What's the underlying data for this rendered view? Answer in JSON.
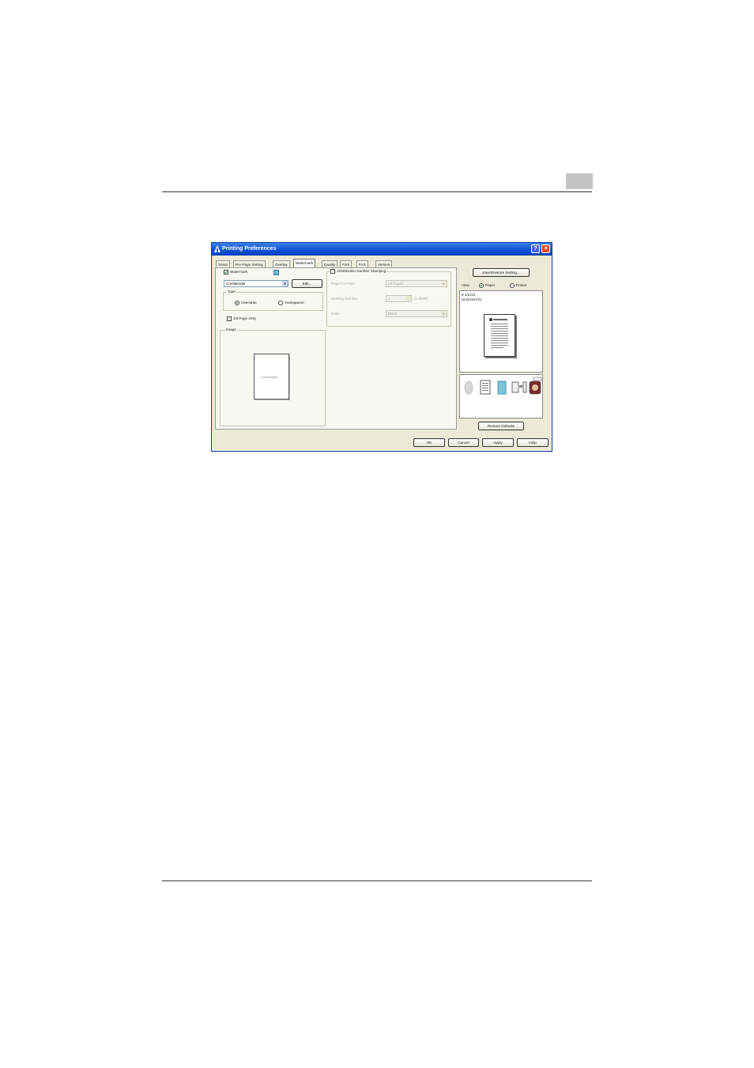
{
  "dialog": {
    "title": "Printing Preferences",
    "help_glyph": "?",
    "close_glyph": "×",
    "tabs": [
      "Setup",
      "Per Page Setting",
      "Overlay",
      "Watermark",
      "Quality",
      "Font",
      "FAX",
      "Version"
    ],
    "active_tab": "Watermark",
    "watermark": {
      "checkbox_label": "Watermark",
      "selected": "Confidential",
      "edit_label": "Edit...",
      "type_label": "Type",
      "overwrite_label": "Overwrite",
      "transparent_label": "Transparent",
      "first_page_label": "1st Page Only",
      "image_label": "Image",
      "preview_text": "Confidential"
    },
    "distribution": {
      "checkbox_label": "Distribution Number Stamping",
      "pages_label": "Pages to Print",
      "pages_value": "All Pages",
      "starting_label": "Starting Number",
      "starting_value": "1",
      "range_text": "[1-9999]",
      "color_label": "Color",
      "color_value": "Black"
    },
    "right": {
      "save_button": "Save/Restore Setting...",
      "view_label": "View",
      "paper_label": "Paper",
      "printer_label": "Printer",
      "paper_size": "8 1/2x11",
      "paper_size_in": "(8.5x11inch)",
      "restore_button": "Restore Defaults"
    },
    "footer": {
      "ok": "OK",
      "cancel": "Cancel",
      "apply": "Apply",
      "help": "Help"
    }
  }
}
